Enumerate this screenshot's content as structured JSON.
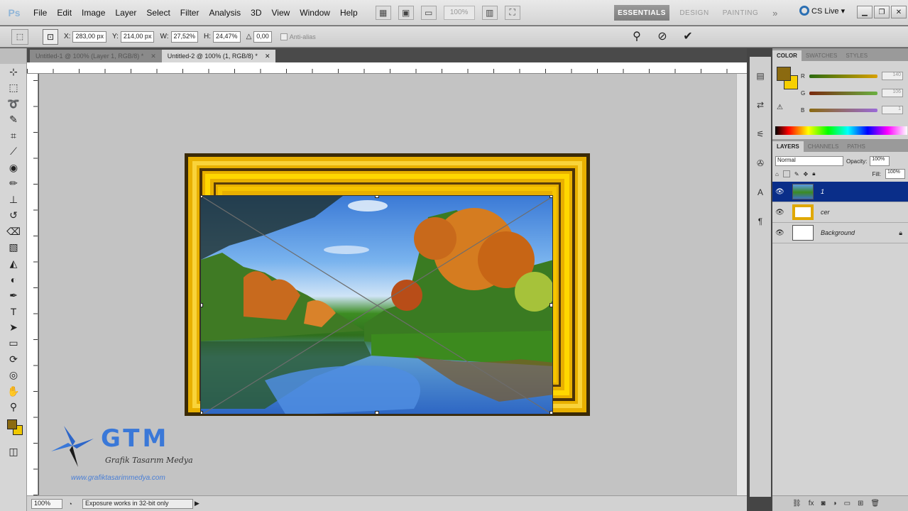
{
  "menu": {
    "logo": "Ps",
    "items": [
      "File",
      "Edit",
      "Image",
      "Layer",
      "Select",
      "Filter",
      "Analysis",
      "3D",
      "View",
      "Window",
      "Help"
    ],
    "zoom_box": "100%",
    "workspaces": {
      "essentials": "ESSENTIALS",
      "design": "DESIGN",
      "painting": "PAINTING",
      "more": "»"
    },
    "cs_live": "CS Live ▾"
  },
  "options": {
    "x_label": "X:",
    "x_value": "283,00 px",
    "y_label": "Y:",
    "y_value": "214,00 px",
    "w_label": "W:",
    "w_value": "27,52%",
    "h_label": "H:",
    "h_value": "24,47%",
    "angle_label": "△",
    "angle_value": "0,00",
    "antialias_label": "Anti-alias"
  },
  "tabs": [
    {
      "label": "Untitled-1 @ 100% (Layer 1, RGB/8) *"
    },
    {
      "label": "Untitled-2 @ 100% (1, RGB/8) *"
    }
  ],
  "status": {
    "zoom": "100%",
    "message": "Exposure works in 32-bit only"
  },
  "watermark": {
    "title": "GTM",
    "subtitle": "Grafik Tasarım Medya",
    "url": "www.grafiktasarimmedya.com"
  },
  "color_panel": {
    "tabs": [
      "COLOR",
      "SWATCHES",
      "STYLES"
    ],
    "channels": [
      {
        "name": "R",
        "value": "140",
        "gradient": [
          "#2a6a10",
          "#d8a000"
        ]
      },
      {
        "name": "G",
        "value": "106",
        "gradient": [
          "#7a2a10",
          "#6ab040"
        ]
      },
      {
        "name": "B",
        "value": "1",
        "gradient": [
          "#8a6a10",
          "#9a6ad8"
        ]
      }
    ],
    "fg_color": "#8b6a10",
    "bg_color": "#f7d000"
  },
  "layers_panel": {
    "tabs": [
      "LAYERS",
      "CHANNELS",
      "PATHS"
    ],
    "blend_mode": "Normal",
    "opacity_label": "Opacity:",
    "opacity_value": "100%",
    "fill_label": "Fill:",
    "fill_value": "100%",
    "layers": [
      {
        "name": "1",
        "selected": true
      },
      {
        "name": "cer",
        "selected": false
      },
      {
        "name": "Background",
        "selected": false,
        "locked": true
      }
    ]
  },
  "colors": {
    "selection": "#0a2e89",
    "canvas_bg": "#c3c3c3",
    "frame_gold": "#f6c400"
  }
}
